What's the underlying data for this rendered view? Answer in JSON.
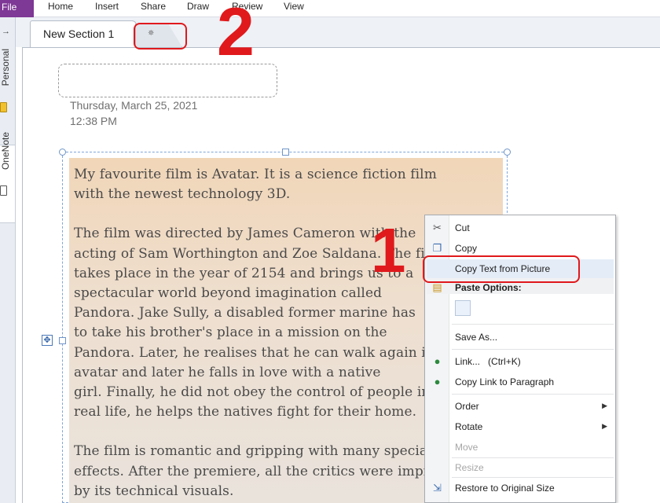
{
  "menubar": {
    "file": "File",
    "items": [
      "Home",
      "Insert",
      "Share",
      "Draw",
      "Review",
      "View"
    ]
  },
  "notebooks": {
    "personal_label": "Personal",
    "onenote_label": "OneNote"
  },
  "section_tabs": {
    "active_label": "New Section 1",
    "new_tab_icon": "new-section-icon"
  },
  "page": {
    "date": "Thursday, March 25, 2021",
    "time": "12:38 PM"
  },
  "picture_text": {
    "paragraphs": [
      [
        "My favourite film is Avatar. It is a science fiction film",
        "with the newest technology 3D."
      ],
      [
        "The film was directed by James Cameron with the",
        "acting of Sam Worthington and Zoe Saldana. The film",
        "takes place in the year of 2154 and brings us to a",
        "spectacular world beyond imagination called",
        "Pandora. Jake Sully, a disabled former marine has",
        "to take his brother's place in a mission on the",
        "Pandora. Later, he realises that he can walk again in",
        "avatar and later he falls in love with a native",
        "girl. Finally, he did not obey the control of people in",
        "real life, he helps the natives fight for their home."
      ],
      [
        "The film is romantic and gripping with many special",
        "effects. After the premiere, all the critics were impressed",
        "by its technical visuals."
      ]
    ]
  },
  "context_menu": {
    "cut": "Cut",
    "copy": "Copy",
    "copy_text_from_picture": "Copy Text from Picture",
    "paste_options": "Paste Options:",
    "save_as": "Save As...",
    "link": "Link...",
    "link_shortcut": "(Ctrl+K)",
    "copy_link": "Copy Link to Paragraph",
    "order": "Order",
    "rotate": "Rotate",
    "move": "Move",
    "resize": "Resize",
    "restore": "Restore to Original Size"
  },
  "annotations": {
    "step_1": "1",
    "step_2": "2",
    "color": "#e0191c"
  },
  "colors": {
    "file_tab": "#7e3895",
    "picture_bg": "#f1d6b8"
  }
}
